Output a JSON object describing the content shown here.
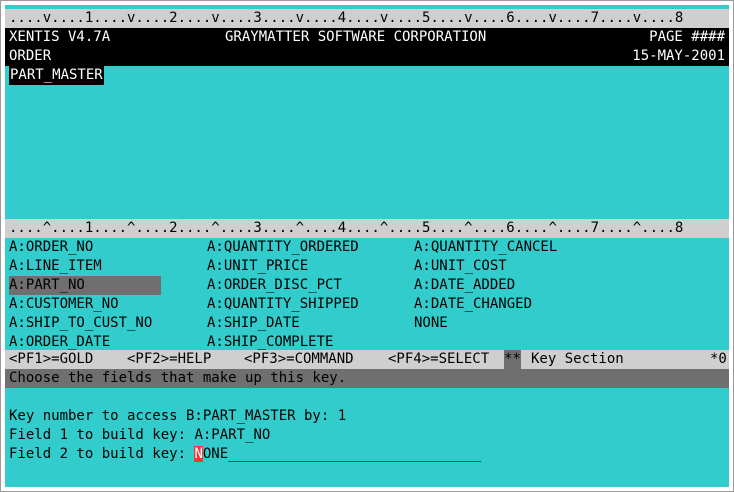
{
  "ruler_top": "....v....1....v....2....v....3....v....4....v....5....v....6....v....7....v....8",
  "header": {
    "app": "XENTIS V4.7A",
    "company": "GRAYMATTER SOFTWARE CORPORATION",
    "page": "PAGE ####",
    "module": "ORDER",
    "date": "15-MAY-2001",
    "table": "PART_MASTER"
  },
  "ruler_mid": "....^....1....^....2....^....3....^....4....^....5....^....6....^....7....^....8",
  "fields": {
    "col1": [
      "A:ORDER_NO",
      "A:LINE_ITEM",
      "A:PART_NO",
      "A:CUSTOMER_NO",
      "A:SHIP_TO_CUST_NO",
      "A:ORDER_DATE"
    ],
    "col2": [
      "A:QUANTITY_ORDERED",
      "A:UNIT_PRICE",
      "A:ORDER_DISC_PCT",
      "A:QUANTITY_SHIPPED",
      "A:SHIP_DATE",
      "A:SHIP_COMPLETE"
    ],
    "col3": [
      "A:QUANTITY_CANCEL",
      "A:UNIT_COST",
      "A:DATE_ADDED",
      "A:DATE_CHANGED",
      "NONE"
    ]
  },
  "pf_bar": {
    "pf1": "<PF1>=GOLD",
    "pf2": "<PF2>=HELP",
    "pf3": "<PF3>=COMMAND",
    "pf4": "<PF4>=SELECT",
    "stars": "**",
    "section": "Key Section",
    "flag": "*0"
  },
  "message": "Choose the fields that make up this key.",
  "form": {
    "key_line": "Key number to access B:PART_MASTER by: 1",
    "field1_label": "Field 1 to build key: ",
    "field1_value": "A:PART_NO",
    "field2_label": "Field 2 to build key: ",
    "field2_cursor_char": "N",
    "field2_rest": "ONE______________________________"
  }
}
